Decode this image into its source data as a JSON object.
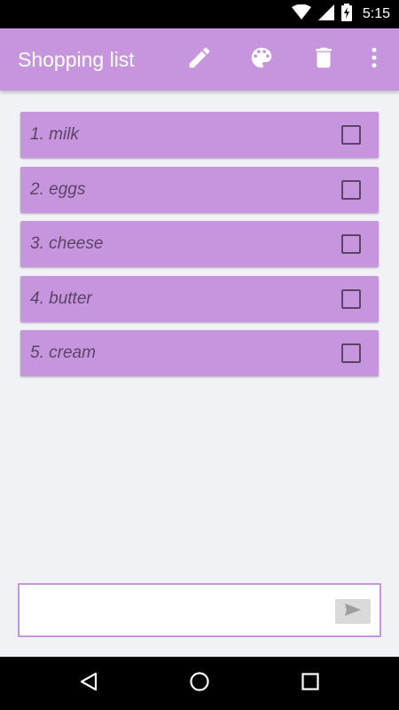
{
  "status_bar": {
    "time": "5:15",
    "icons": [
      "wifi-icon",
      "signal-icon",
      "battery-charging-icon"
    ]
  },
  "app_bar": {
    "title": "Shopping list",
    "actions": [
      "edit-icon",
      "palette-icon",
      "delete-icon",
      "more-vert-icon"
    ],
    "background_color": "#c795dd"
  },
  "list": {
    "items": [
      {
        "label": "1. milk",
        "checked": false
      },
      {
        "label": "2. eggs",
        "checked": false
      },
      {
        "label": "3. cheese",
        "checked": false
      },
      {
        "label": "4. butter",
        "checked": false
      },
      {
        "label": "5. cream",
        "checked": false
      }
    ],
    "item_color": "#c795dd",
    "text_color": "#5b4466"
  },
  "composer": {
    "value": "",
    "send_icon": "send-icon"
  },
  "nav_bar": {
    "buttons": [
      "back-icon",
      "home-icon",
      "recents-icon"
    ]
  }
}
